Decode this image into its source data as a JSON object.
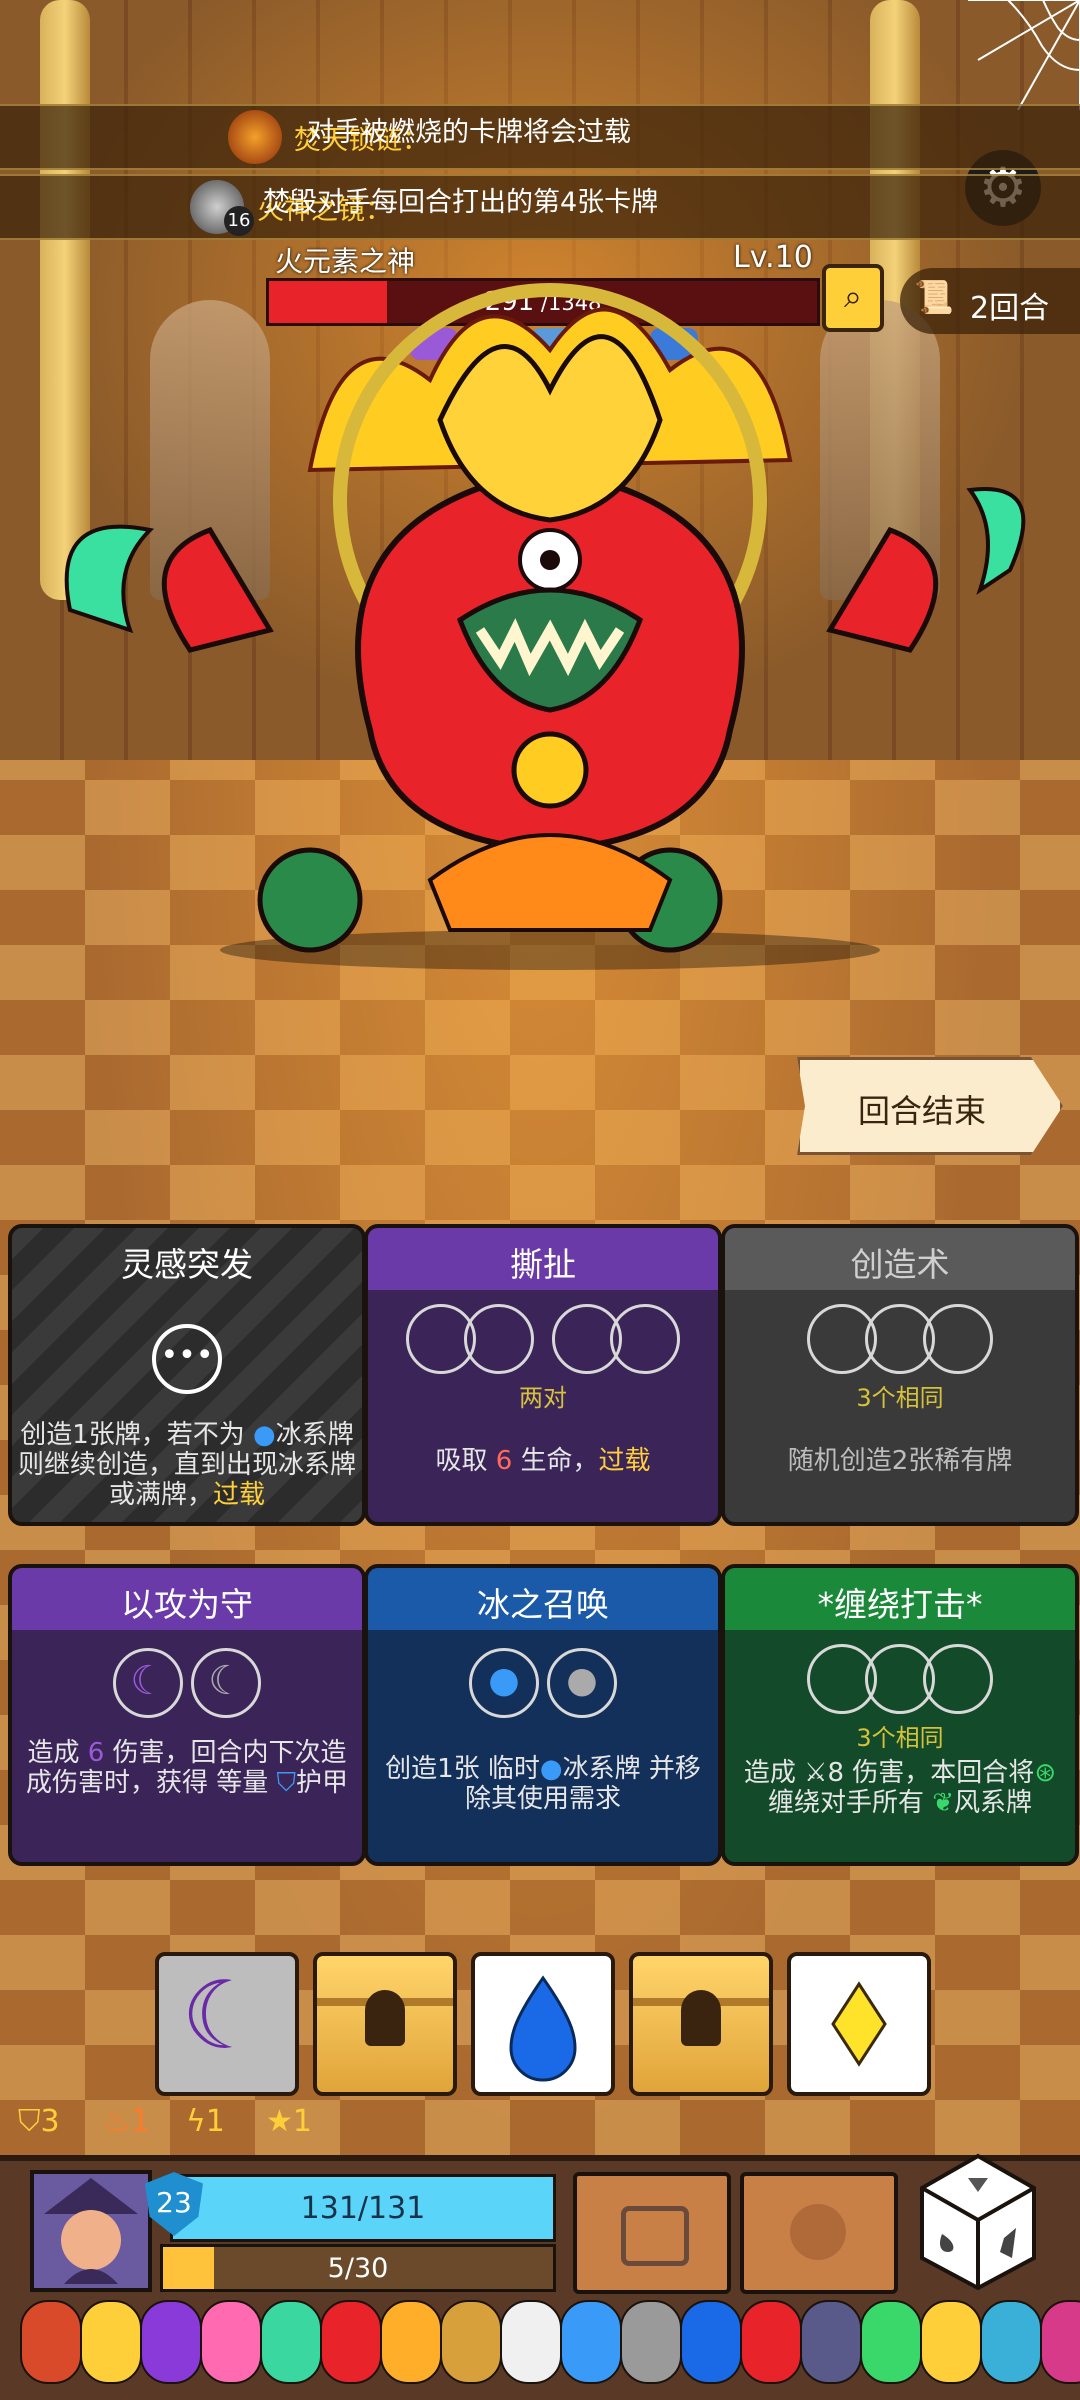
{
  "buffs": [
    {
      "name": "焚天锁链：",
      "desc": "对手被燃烧的卡牌将会过载"
    },
    {
      "name": "火神之镜：",
      "desc": "焚毁对手每回合打出的第4张卡牌",
      "badge": "16"
    }
  ],
  "boss": {
    "name": "火元素之神",
    "level": "Lv.10",
    "hp_current": "291",
    "hp_max": " /1348",
    "hp_fraction": 0.216
  },
  "turn": {
    "label": "2回合"
  },
  "end_turn": {
    "label": "回合结束"
  },
  "cards": [
    {
      "title": "灵感突发",
      "desc_parts": [
        "创造1张牌，若不为",
        "冰系牌则继续创造，直到出现冰系牌或满牌，",
        "过载"
      ]
    },
    {
      "title": "撕扯",
      "req": "两对",
      "desc_parts": [
        "吸取",
        "6",
        "生命，",
        "过载"
      ]
    },
    {
      "title": "创造术",
      "req": "3个相同",
      "desc": "随机创造2张稀有牌"
    },
    {
      "title": "以攻为守",
      "desc_parts": [
        "造成",
        "6",
        "伤害，回合内下次造成伤害时，获得 等量",
        "护甲"
      ]
    },
    {
      "title": "冰之召唤",
      "desc_parts": [
        "创造1张 临时",
        "冰系牌 并移除其使用需求"
      ]
    },
    {
      "title": "*缠绕打击*",
      "req": "3个相同",
      "desc_parts": [
        "造成",
        "8",
        "伤害，本回合将",
        "缠绕对手所有",
        "风系牌"
      ]
    }
  ],
  "resources": [
    {
      "value": "3"
    },
    {
      "value": "1"
    },
    {
      "value": "1"
    },
    {
      "value": "1"
    }
  ],
  "player": {
    "shield": "23",
    "hp": "131/131",
    "xp": "5/30",
    "xp_fraction": 0.13
  },
  "colors": {
    "accent": "#ffcf3a",
    "hp": "#e8232a",
    "shield": "#5ad4f8"
  }
}
